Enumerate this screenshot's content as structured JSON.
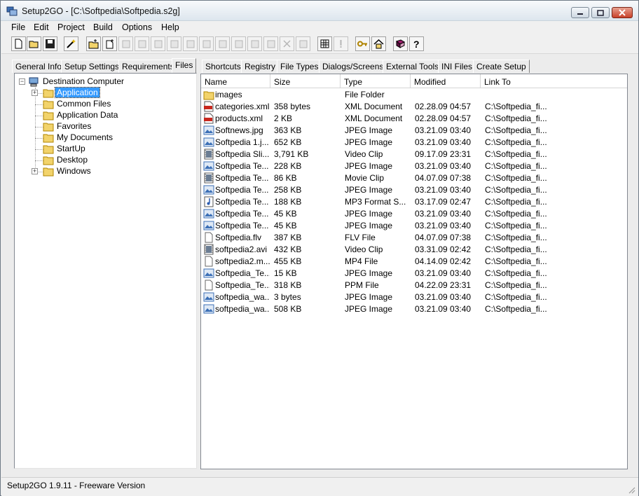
{
  "window": {
    "title": "Setup2GO - [C:\\Softpedia\\Softpedia.s2g]"
  },
  "menu": [
    "File",
    "Edit",
    "Project",
    "Build",
    "Options",
    "Help"
  ],
  "left_tabs": [
    "General Info",
    "Setup Settings",
    "Requirements",
    "Files"
  ],
  "right_tabs": [
    "Shortcuts",
    "Registry",
    "File Types",
    "Dialogs/Screens",
    "External Tools",
    "INI Files",
    "Create Setup"
  ],
  "tree": {
    "root": "Destination Computer",
    "children": [
      "Application",
      "Common Files",
      "Application Data",
      "Favorites",
      "My Documents",
      "StartUp",
      "Desktop",
      "Windows"
    ]
  },
  "list": {
    "columns": [
      "Name",
      "Size",
      "Type",
      "Modified",
      "Link To"
    ],
    "rows": [
      {
        "icon": "folder",
        "name": "images",
        "size": "",
        "type": "File Folder",
        "modified": "",
        "link": ""
      },
      {
        "icon": "xml",
        "name": "categories.xml",
        "size": "358 bytes",
        "type": "XML Document",
        "modified": "02.28.09 04:57",
        "link": "C:\\Softpedia_fi..."
      },
      {
        "icon": "xml",
        "name": "products.xml",
        "size": "2 KB",
        "type": "XML Document",
        "modified": "02.28.09 04:57",
        "link": "C:\\Softpedia_fi..."
      },
      {
        "icon": "image",
        "name": "Softnews.jpg",
        "size": "363 KB",
        "type": "JPEG Image",
        "modified": "03.21.09 03:40",
        "link": "C:\\Softpedia_fi..."
      },
      {
        "icon": "image",
        "name": "Softpedia 1.j...",
        "size": "652 KB",
        "type": "JPEG Image",
        "modified": "03.21.09 03:40",
        "link": "C:\\Softpedia_fi..."
      },
      {
        "icon": "video",
        "name": "Softpedia Sli...",
        "size": "3,791 KB",
        "type": "Video Clip",
        "modified": "09.17.09 23:31",
        "link": "C:\\Softpedia_fi..."
      },
      {
        "icon": "image",
        "name": "Softpedia Te...",
        "size": "228 KB",
        "type": "JPEG Image",
        "modified": "03.21.09 03:40",
        "link": "C:\\Softpedia_fi..."
      },
      {
        "icon": "video",
        "name": "Softpedia Te...",
        "size": "86 KB",
        "type": "Movie Clip",
        "modified": "04.07.09 07:38",
        "link": "C:\\Softpedia_fi..."
      },
      {
        "icon": "image",
        "name": "Softpedia Te...",
        "size": "258 KB",
        "type": "JPEG Image",
        "modified": "03.21.09 03:40",
        "link": "C:\\Softpedia_fi..."
      },
      {
        "icon": "audio",
        "name": "Softpedia Te...",
        "size": "188 KB",
        "type": "MP3 Format S...",
        "modified": "03.17.09 02:47",
        "link": "C:\\Softpedia_fi..."
      },
      {
        "icon": "image",
        "name": "Softpedia Te...",
        "size": "45 KB",
        "type": "JPEG Image",
        "modified": "03.21.09 03:40",
        "link": "C:\\Softpedia_fi..."
      },
      {
        "icon": "image",
        "name": "Softpedia Te...",
        "size": "45 KB",
        "type": "JPEG Image",
        "modified": "03.21.09 03:40",
        "link": "C:\\Softpedia_fi..."
      },
      {
        "icon": "file",
        "name": "Softpedia.flv",
        "size": "387 KB",
        "type": "FLV File",
        "modified": "04.07.09 07:38",
        "link": "C:\\Softpedia_fi..."
      },
      {
        "icon": "video",
        "name": "softpedia2.avi",
        "size": "432 KB",
        "type": "Video Clip",
        "modified": "03.31.09 02:42",
        "link": "C:\\Softpedia_fi..."
      },
      {
        "icon": "file",
        "name": "softpedia2.m...",
        "size": "455 KB",
        "type": "MP4 File",
        "modified": "04.14.09 02:42",
        "link": "C:\\Softpedia_fi..."
      },
      {
        "icon": "image",
        "name": "Softpedia_Te...",
        "size": "15 KB",
        "type": "JPEG Image",
        "modified": "03.21.09 03:40",
        "link": "C:\\Softpedia_fi..."
      },
      {
        "icon": "file",
        "name": "Softpedia_Te...",
        "size": "318 KB",
        "type": "PPM File",
        "modified": "04.22.09 23:31",
        "link": "C:\\Softpedia_fi..."
      },
      {
        "icon": "image",
        "name": "softpedia_wa...",
        "size": "3 bytes",
        "type": "JPEG Image",
        "modified": "03.21.09 03:40",
        "link": "C:\\Softpedia_fi..."
      },
      {
        "icon": "image",
        "name": "softpedia_wa...",
        "size": "508 KB",
        "type": "JPEG Image",
        "modified": "03.21.09 03:40",
        "link": "C:\\Softpedia_fi..."
      }
    ]
  },
  "status": "Setup2GO 1.9.11 - Freeware Version"
}
